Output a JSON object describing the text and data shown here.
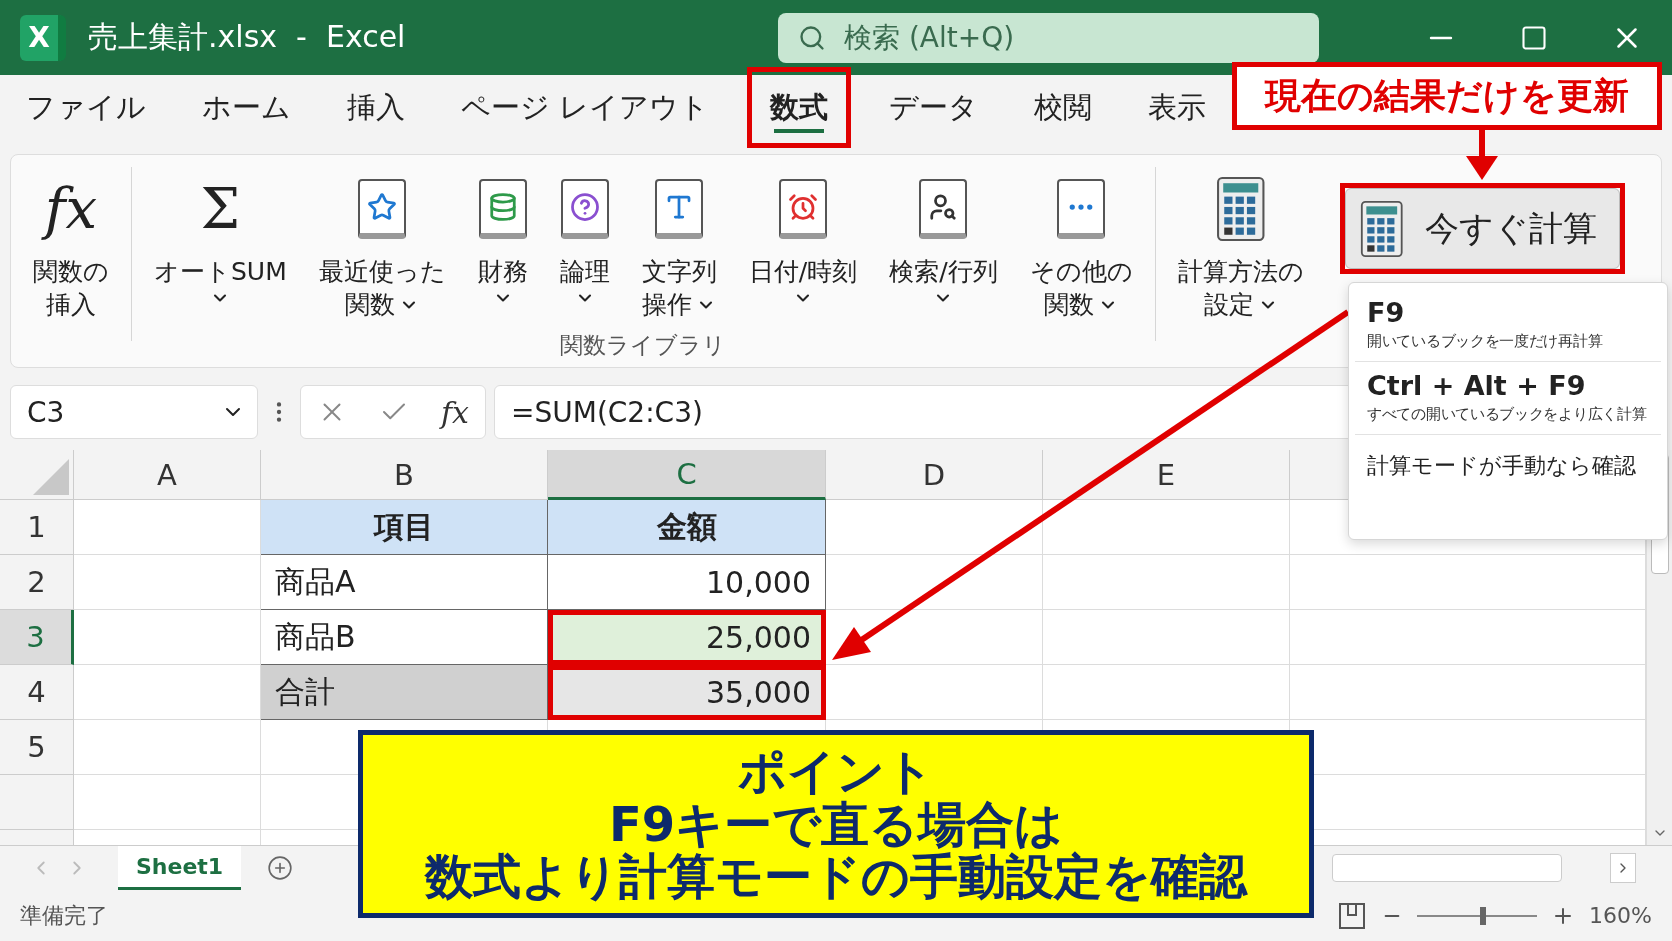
{
  "window": {
    "logo": "X",
    "title": "売上集計.xlsx  -  Excel",
    "search_placeholder": "検索 (Alt+Q)"
  },
  "menu_tabs": [
    {
      "label": "ファイル",
      "selected": false,
      "highlighted": false
    },
    {
      "label": "ホーム",
      "selected": false,
      "highlighted": false
    },
    {
      "label": "挿入",
      "selected": false,
      "highlighted": false
    },
    {
      "label": "ページ レイアウト",
      "selected": false,
      "highlighted": false
    },
    {
      "label": "数式",
      "selected": true,
      "highlighted": true
    },
    {
      "label": "データ",
      "selected": false,
      "highlighted": false
    },
    {
      "label": "校閲",
      "selected": false,
      "highlighted": false
    },
    {
      "label": "表示",
      "selected": false,
      "highlighted": false
    }
  ],
  "ribbon": {
    "groups": [
      {
        "items": [
          {
            "kind": "large",
            "glyph": "fx",
            "lines": [
              "関数の",
              "挿入"
            ],
            "dropdown": false,
            "highlighted": false
          }
        ]
      },
      {
        "label": "関数ライブラリ",
        "items": [
          {
            "kind": "large",
            "glyph": "Σ",
            "lines": [
              "オートSUM"
            ],
            "dropdown": true,
            "highlighted": false
          },
          {
            "kind": "large",
            "lines": [
              "最近使った",
              "関数"
            ],
            "dropdown": true,
            "highlighted": false
          },
          {
            "kind": "large",
            "lines": [
              "財務"
            ],
            "dropdown": true,
            "highlighted": false
          },
          {
            "kind": "large",
            "lines": [
              "論理"
            ],
            "dropdown": true,
            "highlighted": false
          },
          {
            "kind": "large",
            "lines": [
              "文字列",
              "操作"
            ],
            "dropdown": true,
            "highlighted": false
          },
          {
            "kind": "large",
            "lines": [
              "日付/時刻"
            ],
            "dropdown": true,
            "highlighted": false
          },
          {
            "kind": "large",
            "lines": [
              "検索/行列"
            ],
            "dropdown": true,
            "highlighted": false
          },
          {
            "kind": "large",
            "lines": [
              "その他の",
              "関数"
            ],
            "dropdown": true,
            "highlighted": false
          }
        ]
      },
      {
        "items": [
          {
            "kind": "large",
            "lines": [
              "計算方法の",
              "設定"
            ],
            "dropdown": true,
            "highlighted": false
          },
          {
            "kind": "button",
            "lines": [
              "今すぐ計算"
            ],
            "dropdown": false,
            "highlighted": true
          }
        ]
      }
    ]
  },
  "formula_bar": {
    "name_box": "C3",
    "fx": "fx",
    "formula": "=SUM(C2:C3)"
  },
  "sheet": {
    "columns": [
      {
        "label": "A",
        "selected": false
      },
      {
        "label": "B",
        "selected": false
      },
      {
        "label": "C",
        "selected": true
      },
      {
        "label": "D",
        "selected": false
      },
      {
        "label": "E",
        "selected": false
      }
    ],
    "rows": [
      {
        "number": "1",
        "selected": false,
        "kind": "header",
        "item": "項目",
        "amount": "金額",
        "highlighted": false
      },
      {
        "number": "2",
        "selected": false,
        "kind": "item",
        "item": "商品A",
        "amount": "10,000",
        "highlighted": false
      },
      {
        "number": "3",
        "selected": true,
        "kind": "item",
        "item": "商品B",
        "amount": "25,000",
        "highlighted": true
      },
      {
        "number": "4",
        "selected": false,
        "kind": "total",
        "item": "合計",
        "amount": "35,000",
        "highlighted": true
      },
      {
        "number": "5",
        "selected": false,
        "kind": "blank",
        "highlighted": false
      }
    ]
  },
  "calc_menu": {
    "items": [
      {
        "kind": "shortcut",
        "key": "F9",
        "description": "開いているブックを一度だけ再計算"
      },
      {
        "kind": "shortcut",
        "key": "Ctrl + Alt + F9",
        "description": "すべての開いているブックをより広く計算"
      },
      {
        "kind": "command",
        "label": "計算モードが手動なら確認"
      }
    ]
  },
  "callout": "現在の結果だけを更新",
  "note": {
    "title": "ポイント",
    "lines": [
      "F9キーで直る場合は",
      "数式より計算モードの手動設定を確認"
    ]
  },
  "sheet_tabs": [
    {
      "label": "Sheet1",
      "selected": true
    }
  ],
  "status_bar": {
    "status": "準備完了",
    "zoom_slider": {
      "level": 0.55
    },
    "zoom": "160%"
  }
}
